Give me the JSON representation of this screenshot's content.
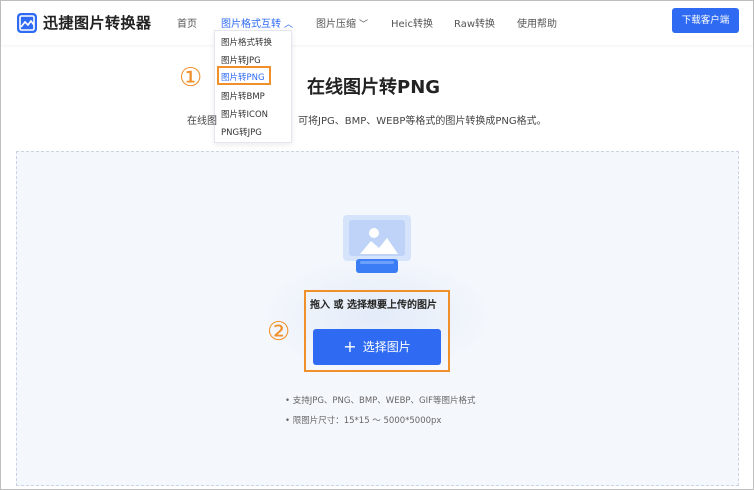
{
  "header": {
    "brand": "迅捷图片转换器",
    "nav": [
      {
        "label": "首页"
      },
      {
        "label": "图片格式互转"
      },
      {
        "label": "图片压缩"
      },
      {
        "label": "Heic转换"
      },
      {
        "label": "Raw转换"
      },
      {
        "label": "使用帮助"
      }
    ],
    "download_label": "下载客户端"
  },
  "dropdown": {
    "items": [
      "图片格式转换",
      "图片转JPG",
      "图片转PNG",
      "图片转BMP",
      "图片转ICON",
      "PNG转JPG"
    ],
    "selected": "图片转PNG"
  },
  "markers": {
    "one": "①",
    "two": "②"
  },
  "page": {
    "title": "在线图片转PNG",
    "desc_left": "在线图",
    "desc_right": "可将JPG、BMP、WEBP等格式的图片转换成PNG格式。"
  },
  "upload": {
    "hint": "拖入 或 选择想要上传的图片",
    "button_plus": "+",
    "button_label": "选择图片",
    "notes": [
      "• 支持JPG、PNG、BMP、WEBP、GIF等图片格式",
      "• 限图片尺寸：15*15 ～ 5000*5000px"
    ]
  },
  "colors": {
    "accent": "#2f6bf2",
    "highlight": "#f0902b"
  },
  "icons": {
    "logo": "image-logo-icon",
    "dropdown_chevron": "chevron-up-icon",
    "compress_chevron": "chevron-down-icon",
    "illustration": "image-upload-illustration"
  }
}
